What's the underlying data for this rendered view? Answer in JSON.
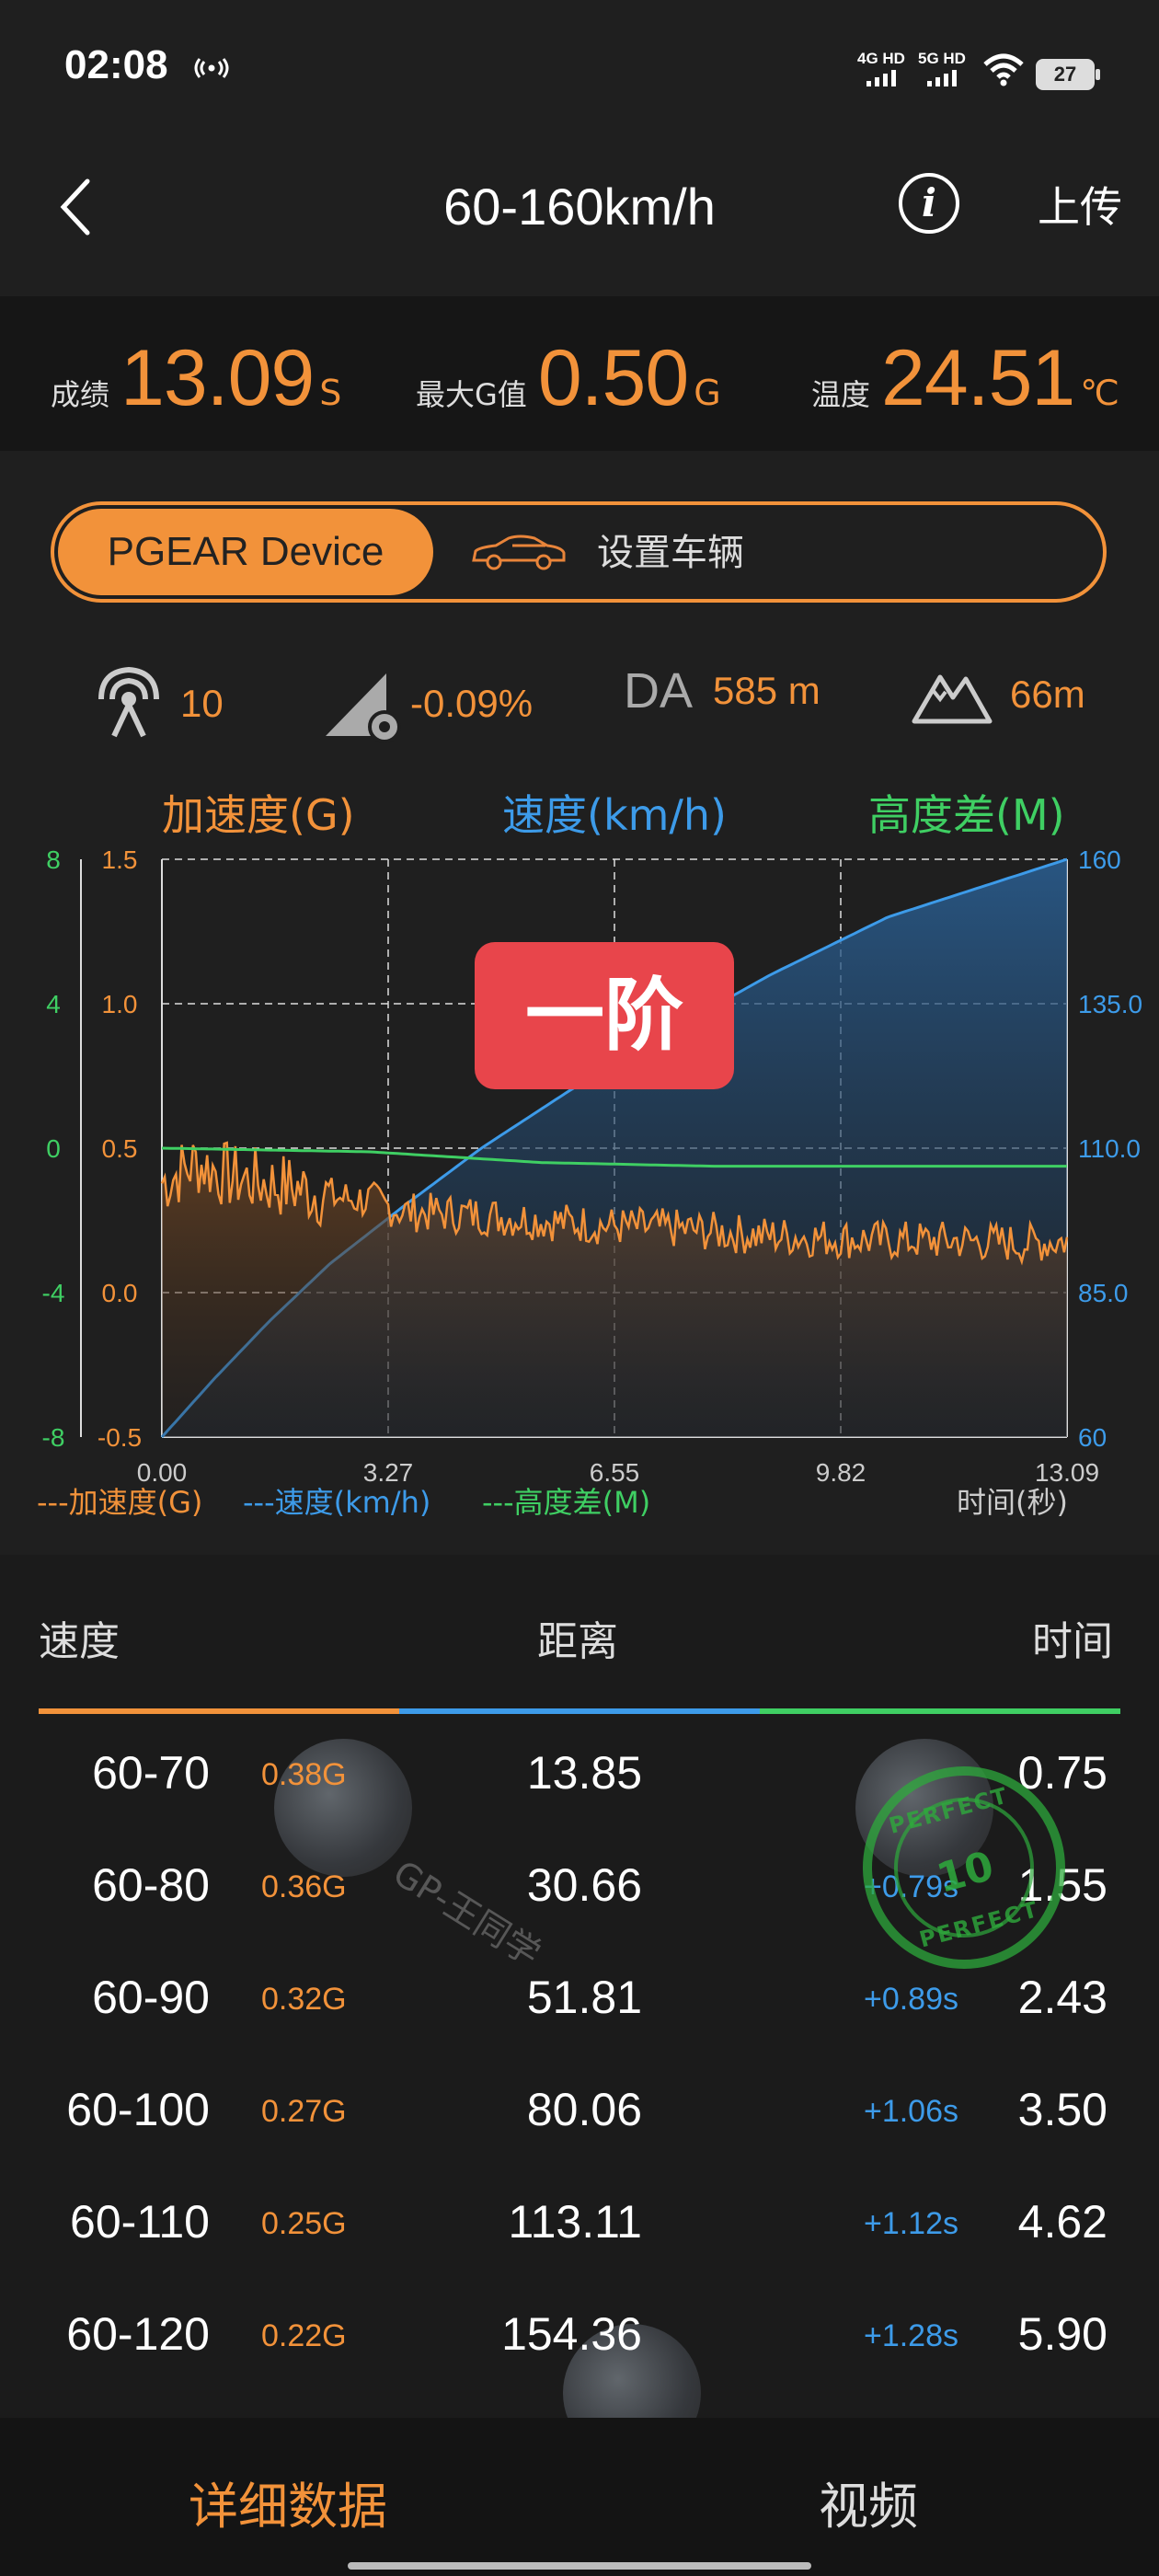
{
  "status_bar": {
    "time": "02:08",
    "net1_label": "4G HD",
    "net2_label": "5G HD",
    "battery": "27"
  },
  "nav": {
    "title": "60-160km/h",
    "upload_label": "上传",
    "info_symbol": "i"
  },
  "summary": {
    "score_label": "成绩",
    "score_value": "13.09",
    "score_unit": "S",
    "maxg_label": "最大G值",
    "maxg_value": "0.50",
    "maxg_unit": "G",
    "temp_label": "温度",
    "temp_value": "24.51",
    "temp_unit": "℃"
  },
  "segmented": {
    "device_label": "PGEAR Device",
    "vehicle_label": "设置车辆"
  },
  "stats": {
    "satellites": "10",
    "slope": "-0.09%",
    "da_label": "DA",
    "da_value": "585 m",
    "altitude": "66m"
  },
  "chart_data": {
    "type": "line",
    "titles": {
      "accel": "加速度(G)",
      "speed": "速度(km/h)",
      "alt": "高度差(M)"
    },
    "badge": "一阶",
    "x_ticks": [
      "0.00",
      "3.27",
      "6.55",
      "9.82",
      "13.09"
    ],
    "x_range": [
      0,
      13.09
    ],
    "x_label": "时间(秒)",
    "accel_axis": {
      "ticks": [
        "1.5",
        "1.0",
        "0.5",
        "0.0",
        "-0.5"
      ],
      "range": [
        -0.5,
        1.5
      ]
    },
    "alt_axis": {
      "ticks": [
        "8",
        "4",
        "0",
        "-4",
        "-8"
      ],
      "range": [
        -8,
        8
      ]
    },
    "speed_axis": {
      "ticks": [
        "160",
        "135.0",
        "110.0",
        "85.0",
        "60"
      ],
      "range": [
        60,
        160
      ]
    },
    "legend": [
      "---加速度(G)",
      "---速度(km/h)",
      "---高度差(M)"
    ],
    "series": [
      {
        "name": "速度(km/h)",
        "color": "#3d9be9",
        "points": [
          [
            0,
            60
          ],
          [
            0.75,
            70
          ],
          [
            1.55,
            80
          ],
          [
            2.43,
            90
          ],
          [
            3.5,
            100
          ],
          [
            4.62,
            110
          ],
          [
            5.9,
            120
          ],
          [
            7.3,
            130
          ],
          [
            8.8,
            140
          ],
          [
            10.5,
            150
          ],
          [
            13.09,
            160
          ]
        ]
      },
      {
        "name": "加速度(G)",
        "color": "#f2923a",
        "points": [
          [
            0,
            0.38
          ],
          [
            0.5,
            0.45
          ],
          [
            1.0,
            0.4
          ],
          [
            1.5,
            0.38
          ],
          [
            2.0,
            0.36
          ],
          [
            2.5,
            0.33
          ],
          [
            3.0,
            0.32
          ],
          [
            3.5,
            0.28
          ],
          [
            4.5,
            0.27
          ],
          [
            5.5,
            0.25
          ],
          [
            6.5,
            0.23
          ],
          [
            7.5,
            0.22
          ],
          [
            8.5,
            0.2
          ],
          [
            9.5,
            0.19
          ],
          [
            10.5,
            0.18
          ],
          [
            11.5,
            0.18
          ],
          [
            12.5,
            0.17
          ],
          [
            13.09,
            0.18
          ]
        ]
      },
      {
        "name": "高度差(M)",
        "color": "#3fcf63",
        "points": [
          [
            0,
            0
          ],
          [
            3,
            -0.1
          ],
          [
            5.5,
            -0.4
          ],
          [
            8,
            -0.5
          ],
          [
            10,
            -0.5
          ],
          [
            13.09,
            -0.5
          ]
        ]
      }
    ]
  },
  "table": {
    "headers": {
      "speed": "速度",
      "distance": "距离",
      "time": "时间"
    },
    "rows": [
      {
        "speed": "60-70",
        "g": "0.38G",
        "distance": "13.85",
        "delta": "",
        "time": "0.75"
      },
      {
        "speed": "60-80",
        "g": "0.36G",
        "distance": "30.66",
        "delta": "+0.79s",
        "time": "1.55"
      },
      {
        "speed": "60-90",
        "g": "0.32G",
        "distance": "51.81",
        "delta": "+0.89s",
        "time": "2.43"
      },
      {
        "speed": "60-100",
        "g": "0.27G",
        "distance": "80.06",
        "delta": "+1.06s",
        "time": "3.50"
      },
      {
        "speed": "60-110",
        "g": "0.25G",
        "distance": "113.11",
        "delta": "+1.12s",
        "time": "4.62"
      },
      {
        "speed": "60-120",
        "g": "0.22G",
        "distance": "154.36",
        "delta": "+1.28s",
        "time": "5.90"
      }
    ],
    "watermark_text": "GP-王同学",
    "stamp_number": "10",
    "stamp_word": "PERFECT"
  },
  "tabs": {
    "details": "详细数据",
    "video": "视频"
  },
  "colors": {
    "accent": "#f2923a",
    "speed": "#3d9be9",
    "altitude": "#3fcf63",
    "badge": "#e8454b",
    "background": "#1f1f1f"
  }
}
